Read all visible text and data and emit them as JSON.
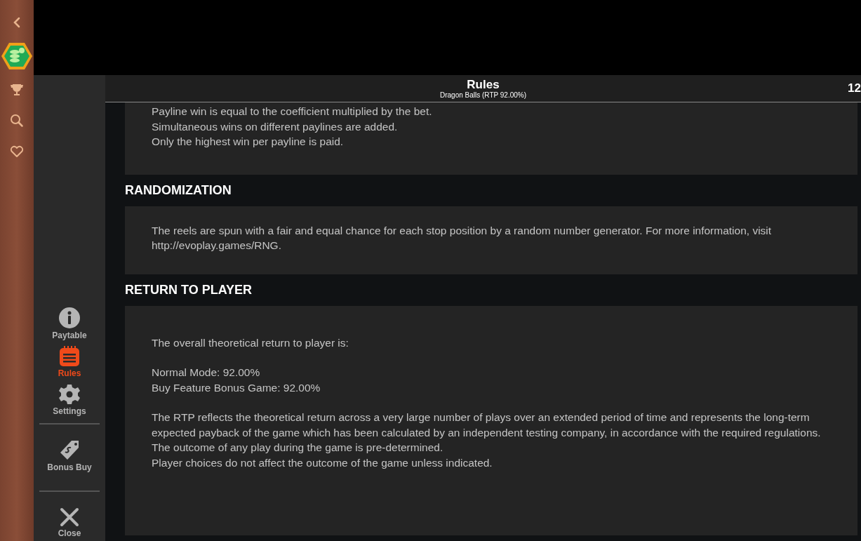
{
  "rail": {
    "items": [
      {
        "kind": "back"
      },
      {
        "kind": "coins",
        "selected": true
      },
      {
        "kind": "trophy"
      },
      {
        "kind": "search"
      },
      {
        "kind": "favorites"
      }
    ]
  },
  "header": {
    "title": "Rules",
    "subtitle": "Dragon Balls (RTP 92.00%)",
    "clock": "12"
  },
  "menu": {
    "items": [
      {
        "kind": "info",
        "label": "Paytable",
        "selected": false
      },
      {
        "kind": "rules",
        "label": "Rules",
        "selected": true
      },
      {
        "kind": "settings",
        "label": "Settings",
        "selected": false
      },
      {
        "kind": "divider"
      },
      {
        "kind": "tag",
        "label": "Bonus Buy",
        "selected": false
      },
      {
        "kind": "divider"
      },
      {
        "kind": "close",
        "label": "Close",
        "selected": false
      }
    ]
  },
  "sections": [
    {
      "paragraphs": [
        [
          "Payline win is equal to the coefficient multiplied by the bet.",
          "Simultaneous wins on different paylines are added.",
          "Only the highest win per payline is paid."
        ]
      ]
    },
    {
      "heading": "RANDOMIZATION",
      "paragraphs": [
        [
          "The reels are spun with a fair and equal chance for each stop position by a random number generator. For more information, visit http://evoplay.games/RNG."
        ]
      ]
    },
    {
      "heading": "RETURN TO PLAYER",
      "paragraphs": [
        [
          "The overall theoretical return to player is:"
        ],
        [
          "Normal Mode: 92.00%",
          "Buy Feature Bonus Game: 92.00%"
        ],
        [
          "The RTP reflects the theoretical return across a very large number of plays over an extended period of time and represents the long-term expected payback of the game which has been calculated by an independent testing company, in accordance with the required regulations.",
          "The outcome of any play during the game is pre-determined.",
          "Player choices do not affect the outcome of the game unless indicated."
        ]
      ]
    }
  ]
}
